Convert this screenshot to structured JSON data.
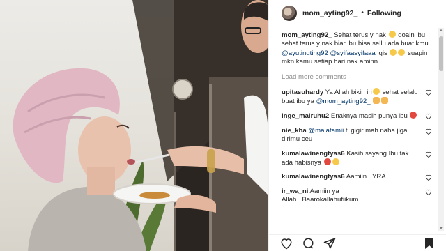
{
  "post": {
    "username": "mom_ayting92_",
    "separator": "•",
    "follow_label": "Following"
  },
  "caption": {
    "username": "mom_ayting92_",
    "part1": "Sehat terus y nak",
    "part2": "doain ibu sehat terus y nak biar ibu bisa sellu ada buat kmu",
    "mention1": "@ayutingting92",
    "mention2": "@syifaasyifaaa",
    "part3": "iqis",
    "part4": "suapin mkn kamu setiap hari nak aminn"
  },
  "load_more_label": "Load more comments",
  "comments": [
    {
      "user": "upitasuhardy",
      "text": "Ya Allah bikin iri",
      "text2": "sehat selalu buat ibu ya",
      "mention": "@mom_ayting92_"
    },
    {
      "user": "inge_mairuhu2",
      "text": "Enaknya masih punya ibu"
    },
    {
      "user": "nie_kha",
      "mention": "@maiatamii",
      "text": "ti gigir mah naha jiga dirimu ceu"
    },
    {
      "user": "kumalawinengtyas6",
      "text": "Kasih sayang Ibu tak ada habisnya"
    },
    {
      "user": "kumalawinengtyas6",
      "text": "Aamiin.. YRA"
    },
    {
      "user": "ir_wa_ni",
      "text": "Aamiin ya Allah...Baarokallahufiikum..."
    }
  ],
  "icons": {
    "like": "heart-outline-icon",
    "comment": "comment-bubble-icon",
    "share": "paper-plane-icon",
    "save": "bookmark-icon"
  },
  "colors": {
    "mention": "#003569",
    "muted": "#8e8e8e",
    "text": "#262626"
  }
}
